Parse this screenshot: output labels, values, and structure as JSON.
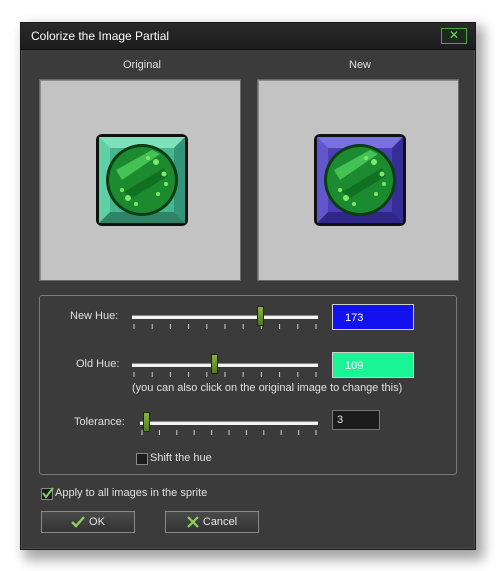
{
  "window": {
    "title": "Colorize the Image Partial",
    "close_glyph": "✕"
  },
  "previews": {
    "original_label": "Original",
    "new_label": "New"
  },
  "controls": {
    "new_hue": {
      "label": "New Hue:",
      "value": "173",
      "swatch_color": "#1212ee",
      "text_color": "#ffffff",
      "level": 0.7
    },
    "old_hue": {
      "label": "Old Hue:",
      "value": "109",
      "swatch_color": "#19f594",
      "text_color": "#ffffff",
      "level": 0.44
    },
    "hint": "(you can also click on the original image to change this)",
    "tolerance": {
      "label": "Tolerance:",
      "value": "3",
      "level": 0.02
    },
    "shift_hue": {
      "label": "Shift the hue",
      "checked": false
    }
  },
  "apply_all": {
    "label": "Apply to all images in the sprite",
    "checked": true
  },
  "buttons": {
    "ok_label": "OK",
    "cancel_label": "Cancel"
  },
  "icons": {
    "ok": "check-icon",
    "cancel": "x-icon"
  }
}
